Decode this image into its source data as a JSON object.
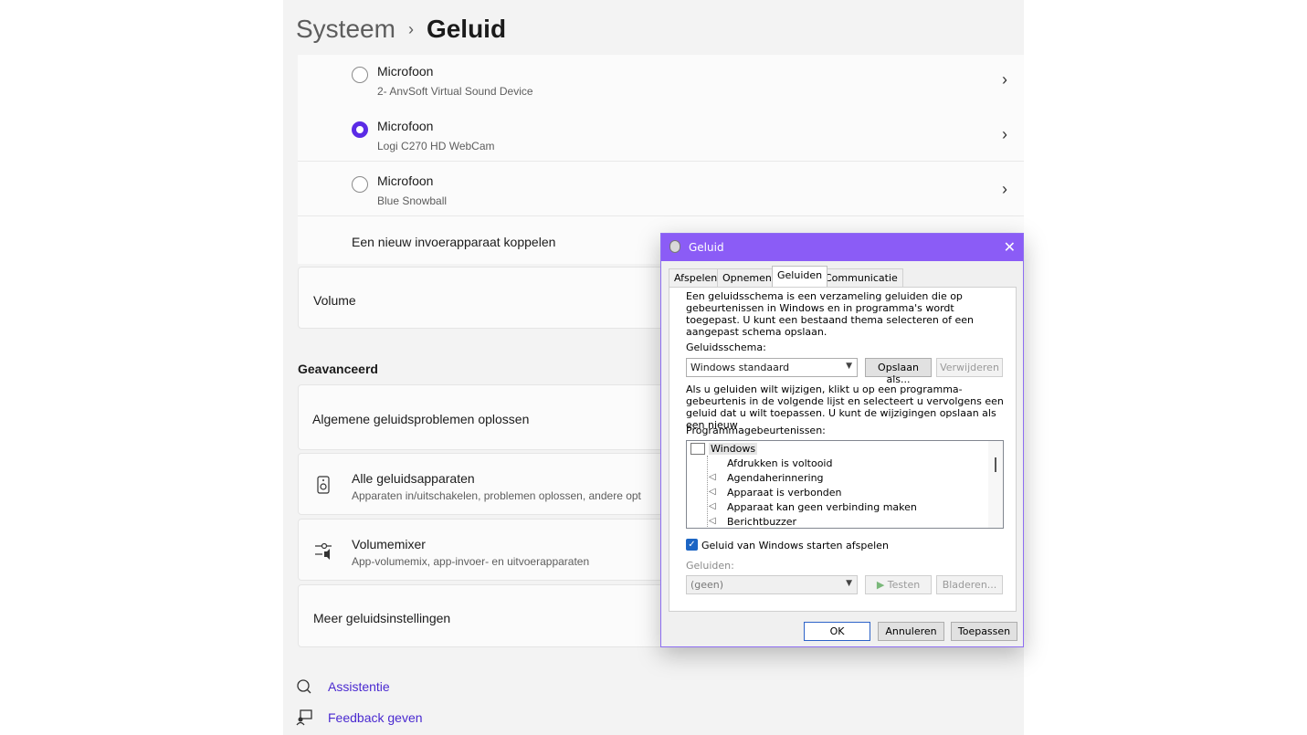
{
  "breadcrumb": {
    "parent": "Systeem",
    "separator": "›",
    "current": "Geluid"
  },
  "inputs": [
    {
      "title": "Microfoon",
      "subtitle": "2- AnvSoft Virtual Sound Device",
      "selected": false
    },
    {
      "title": "Microfoon",
      "subtitle": "Logi C270 HD WebCam",
      "selected": true
    },
    {
      "title": "Microfoon",
      "subtitle": "Blue Snowball",
      "selected": false
    }
  ],
  "pair_input_label": "Een nieuw invoerapparaat koppelen",
  "volume_label": "Volume",
  "advanced": {
    "title": "Geavanceerd",
    "troubleshoot": "Algemene geluidsproblemen oplossen",
    "all_devices": {
      "title": "Alle geluidsapparaten",
      "subtitle": "Apparaten in/uitschakelen, problemen oplossen, andere opt"
    },
    "mixer": {
      "title": "Volumemixer",
      "subtitle": "App-volumemix, app-invoer- en uitvoerapparaten"
    },
    "more": "Meer geluidsinstellingen"
  },
  "links": {
    "help": "Assistentie",
    "feedback": "Feedback geven"
  },
  "chevron": "›",
  "dialog": {
    "title": "Geluid",
    "close": "✕",
    "tabs": [
      "Afspelen",
      "Opnemen",
      "Geluiden",
      "Communicatie"
    ],
    "active_tab": "Geluiden",
    "intro": "Een geluidsschema is een verzameling geluiden die op gebeurtenissen in Windows en in programma's wordt toegepast. U kunt een bestaand thema selecteren of een aangepast schema opslaan.",
    "scheme_label": "Geluidsschema:",
    "scheme_value": "Windows standaard",
    "save_as": "Opslaan als...",
    "delete": "Verwijderen",
    "instructions": "Als u geluiden wilt wijzigen, klikt u op een programma-gebeurtenis in de volgende lijst en selecteert u vervolgens een geluid dat u wilt toepassen. U kunt de wijzigingen opslaan als een nieuw",
    "events_label": "Programmagebeurtenissen:",
    "events_root": "Windows",
    "events": [
      {
        "label": "Afdrukken is voltooid",
        "has_sound": false
      },
      {
        "label": "Agendaherinnering",
        "has_sound": true
      },
      {
        "label": "Apparaat is verbonden",
        "has_sound": true
      },
      {
        "label": "Apparaat kan geen verbinding maken",
        "has_sound": true
      },
      {
        "label": "Berichtbuzzer",
        "has_sound": true
      }
    ],
    "startup_checkbox": "Geluid van Windows starten afspelen",
    "startup_checked": true,
    "sounds_label": "Geluiden:",
    "sounds_value": "(geen)",
    "test": "Testen",
    "browse": "Bladeren...",
    "ok": "OK",
    "cancel": "Annuleren",
    "apply": "Toepassen"
  },
  "colors": {
    "accent": "#5b2be6",
    "titlebar": "#8b5cf6",
    "link": "#4a2ad0"
  }
}
